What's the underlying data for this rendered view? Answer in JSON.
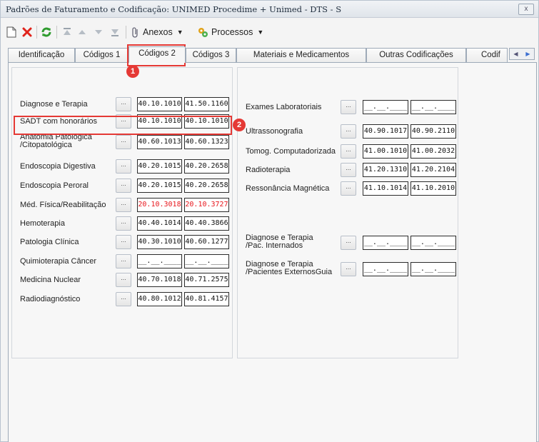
{
  "window": {
    "title": "Padrões de Faturamento e Codificação: UNIMED Procedime + Unimed - DTS - S",
    "close_label": "x"
  },
  "toolbar": {
    "anexos_label": "Anexos",
    "processos_label": "Processos",
    "caret": "▼"
  },
  "tabs": [
    {
      "label": "Identificação"
    },
    {
      "label": "Códigos 1"
    },
    {
      "label": "Códigos 2",
      "active": true
    },
    {
      "label": "Códigos 3"
    },
    {
      "label": "Materiais e Medicamentos"
    },
    {
      "label": "Outras Codificações"
    },
    {
      "label": "Codif"
    }
  ],
  "lookup_button_label": "...",
  "left_group": [
    {
      "label": "Diagnose e Terapia",
      "code1": "40.10.1010",
      "code2": "41.50.1160"
    },
    {
      "label": "SADT com honorários",
      "code1": "40.10.1010",
      "code2": "40.10.1010"
    },
    {
      "label": "Anatomia Patológica\n/Citopatológica",
      "code1": "40.60.1013",
      "code2": "40.60.1323"
    },
    {
      "label": "Endoscopia Digestiva",
      "code1": "40.20.1015",
      "code2": "40.20.2658"
    },
    {
      "label": "Endoscopia Peroral",
      "code1": "40.20.1015",
      "code2": "40.20.2658"
    },
    {
      "label": "Méd. Física/Reabilitação",
      "code1": "20.10.3018",
      "code2": "20.10.3727"
    },
    {
      "label": "Hemoterapia",
      "code1": "40.40.1014",
      "code2": "40.40.3866"
    },
    {
      "label": "Patologia Clínica",
      "code1": "40.30.1010",
      "code2": "40.60.1277"
    },
    {
      "label": "Quimioterapia Câncer",
      "code1": "__.__.____",
      "code2": "__.__.____"
    },
    {
      "label": "Medicina Nuclear",
      "code1": "40.70.1018",
      "code2": "40.71.2575"
    },
    {
      "label": "Radiodiagnóstico",
      "code1": "40.80.1012",
      "code2": "40.81.4157"
    }
  ],
  "right_group": [
    {
      "label": "Exames Laboratoriais",
      "code1": "__.__.____",
      "code2": "__.__.____"
    },
    {
      "label": "Ultrassonografia",
      "code1": "40.90.1017",
      "code2": "40.90.2110"
    },
    {
      "label": "Tomog. Computadorizada",
      "code1": "41.00.1010",
      "code2": "41.00.2032"
    },
    {
      "label": "Radioterapia",
      "code1": "41.20.1310",
      "code2": "41.20.2104"
    },
    {
      "label": "Ressonância Magnética",
      "code1": "41.10.1014",
      "code2": "41.10.2010"
    },
    {
      "label": "Diagnose e Terapia\n/Pac. Internados",
      "code1": "__.__.____",
      "code2": "__.__.____"
    },
    {
      "label": "Diagnose e Terapia\n/Pacientes ExternosGuia",
      "code1": "__.__.____",
      "code2": "__.__.____"
    }
  ],
  "annotations": {
    "badge1": "1",
    "badge2": "2"
  },
  "colors": {
    "highlight": "#e53935",
    "red_code": "#e8151b"
  }
}
